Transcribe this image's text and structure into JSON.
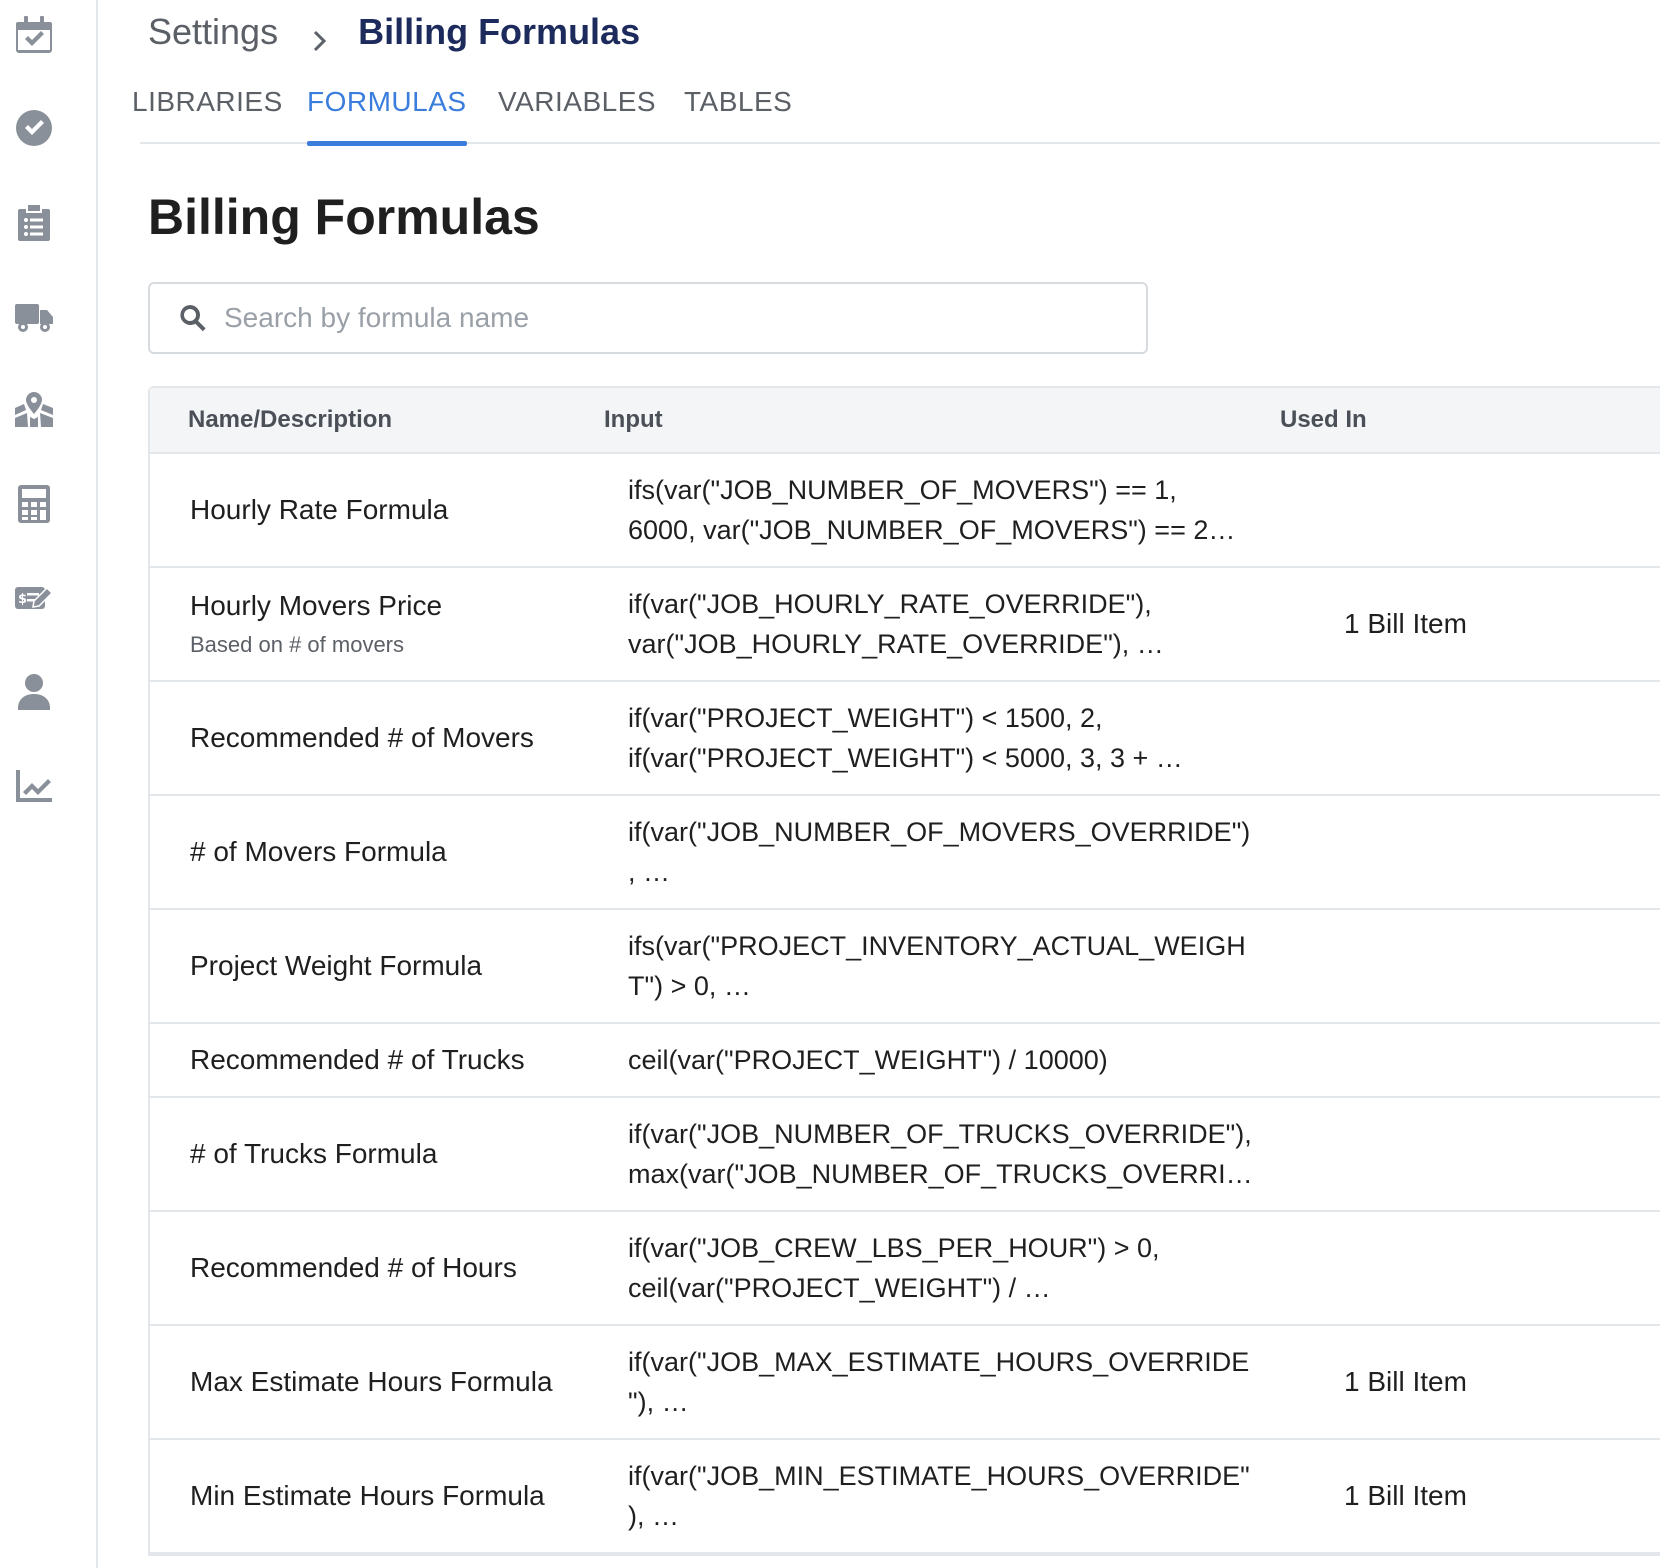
{
  "sidebar": {
    "icons": [
      "calendar-check-icon",
      "check-circle-icon",
      "clipboard-list-icon",
      "truck-icon",
      "map-marked-icon",
      "calculator-icon",
      "money-check-edit-icon",
      "user-icon",
      "chart-line-icon"
    ]
  },
  "breadcrumb": {
    "parent": "Settings",
    "current": "Billing Formulas"
  },
  "tabs": [
    {
      "label": "LIBRARIES",
      "active": false
    },
    {
      "label": "FORMULAS",
      "active": true
    },
    {
      "label": "VARIABLES",
      "active": false
    },
    {
      "label": "TABLES",
      "active": false
    }
  ],
  "page_title": "Billing Formulas",
  "search": {
    "placeholder": "Search by formula name",
    "value": ""
  },
  "table": {
    "headers": {
      "name": "Name/Description",
      "input": "Input",
      "used_in": "Used In"
    },
    "rows": [
      {
        "name": "Hourly Rate Formula",
        "description": "",
        "input": "ifs(var(\"JOB_NUMBER_OF_MOVERS\") == 1,\n6000, var(\"JOB_NUMBER_OF_MOVERS\") == 2…",
        "used_in": ""
      },
      {
        "name": "Hourly Movers Price",
        "description": "Based on # of movers",
        "input": "if(var(\"JOB_HOURLY_RATE_OVERRIDE\"),\nvar(\"JOB_HOURLY_RATE_OVERRIDE\"), …",
        "used_in": "1 Bill Item"
      },
      {
        "name": "Recommended # of Movers",
        "description": "",
        "input": "if(var(\"PROJECT_WEIGHT\") < 1500, 2,\nif(var(\"PROJECT_WEIGHT\") < 5000, 3, 3 + …",
        "used_in": ""
      },
      {
        "name": "# of Movers Formula",
        "description": "",
        "input": "if(var(\"JOB_NUMBER_OF_MOVERS_OVERRIDE\")\n, …",
        "used_in": ""
      },
      {
        "name": "Project Weight Formula",
        "description": "",
        "input": "ifs(var(\"PROJECT_INVENTORY_ACTUAL_WEIGH\nT\") > 0, …",
        "used_in": ""
      },
      {
        "name": "Recommended # of Trucks",
        "description": "",
        "input": "ceil(var(\"PROJECT_WEIGHT\") / 10000)",
        "used_in": ""
      },
      {
        "name": "# of Trucks Formula",
        "description": "",
        "input": "if(var(\"JOB_NUMBER_OF_TRUCKS_OVERRIDE\"),\nmax(var(\"JOB_NUMBER_OF_TRUCKS_OVERRI…",
        "used_in": ""
      },
      {
        "name": "Recommended # of Hours",
        "description": "",
        "input": "if(var(\"JOB_CREW_LBS_PER_HOUR\") > 0,\nceil(var(\"PROJECT_WEIGHT\") / …",
        "used_in": ""
      },
      {
        "name": "Max Estimate Hours Formula",
        "description": "",
        "input": "if(var(\"JOB_MAX_ESTIMATE_HOURS_OVERRIDE\n\"), …",
        "used_in": "1 Bill Item"
      },
      {
        "name": "Min Estimate Hours Formula",
        "description": "",
        "input": "if(var(\"JOB_MIN_ESTIMATE_HOURS_OVERRIDE\"\n), …",
        "used_in": "1 Bill Item"
      }
    ]
  }
}
